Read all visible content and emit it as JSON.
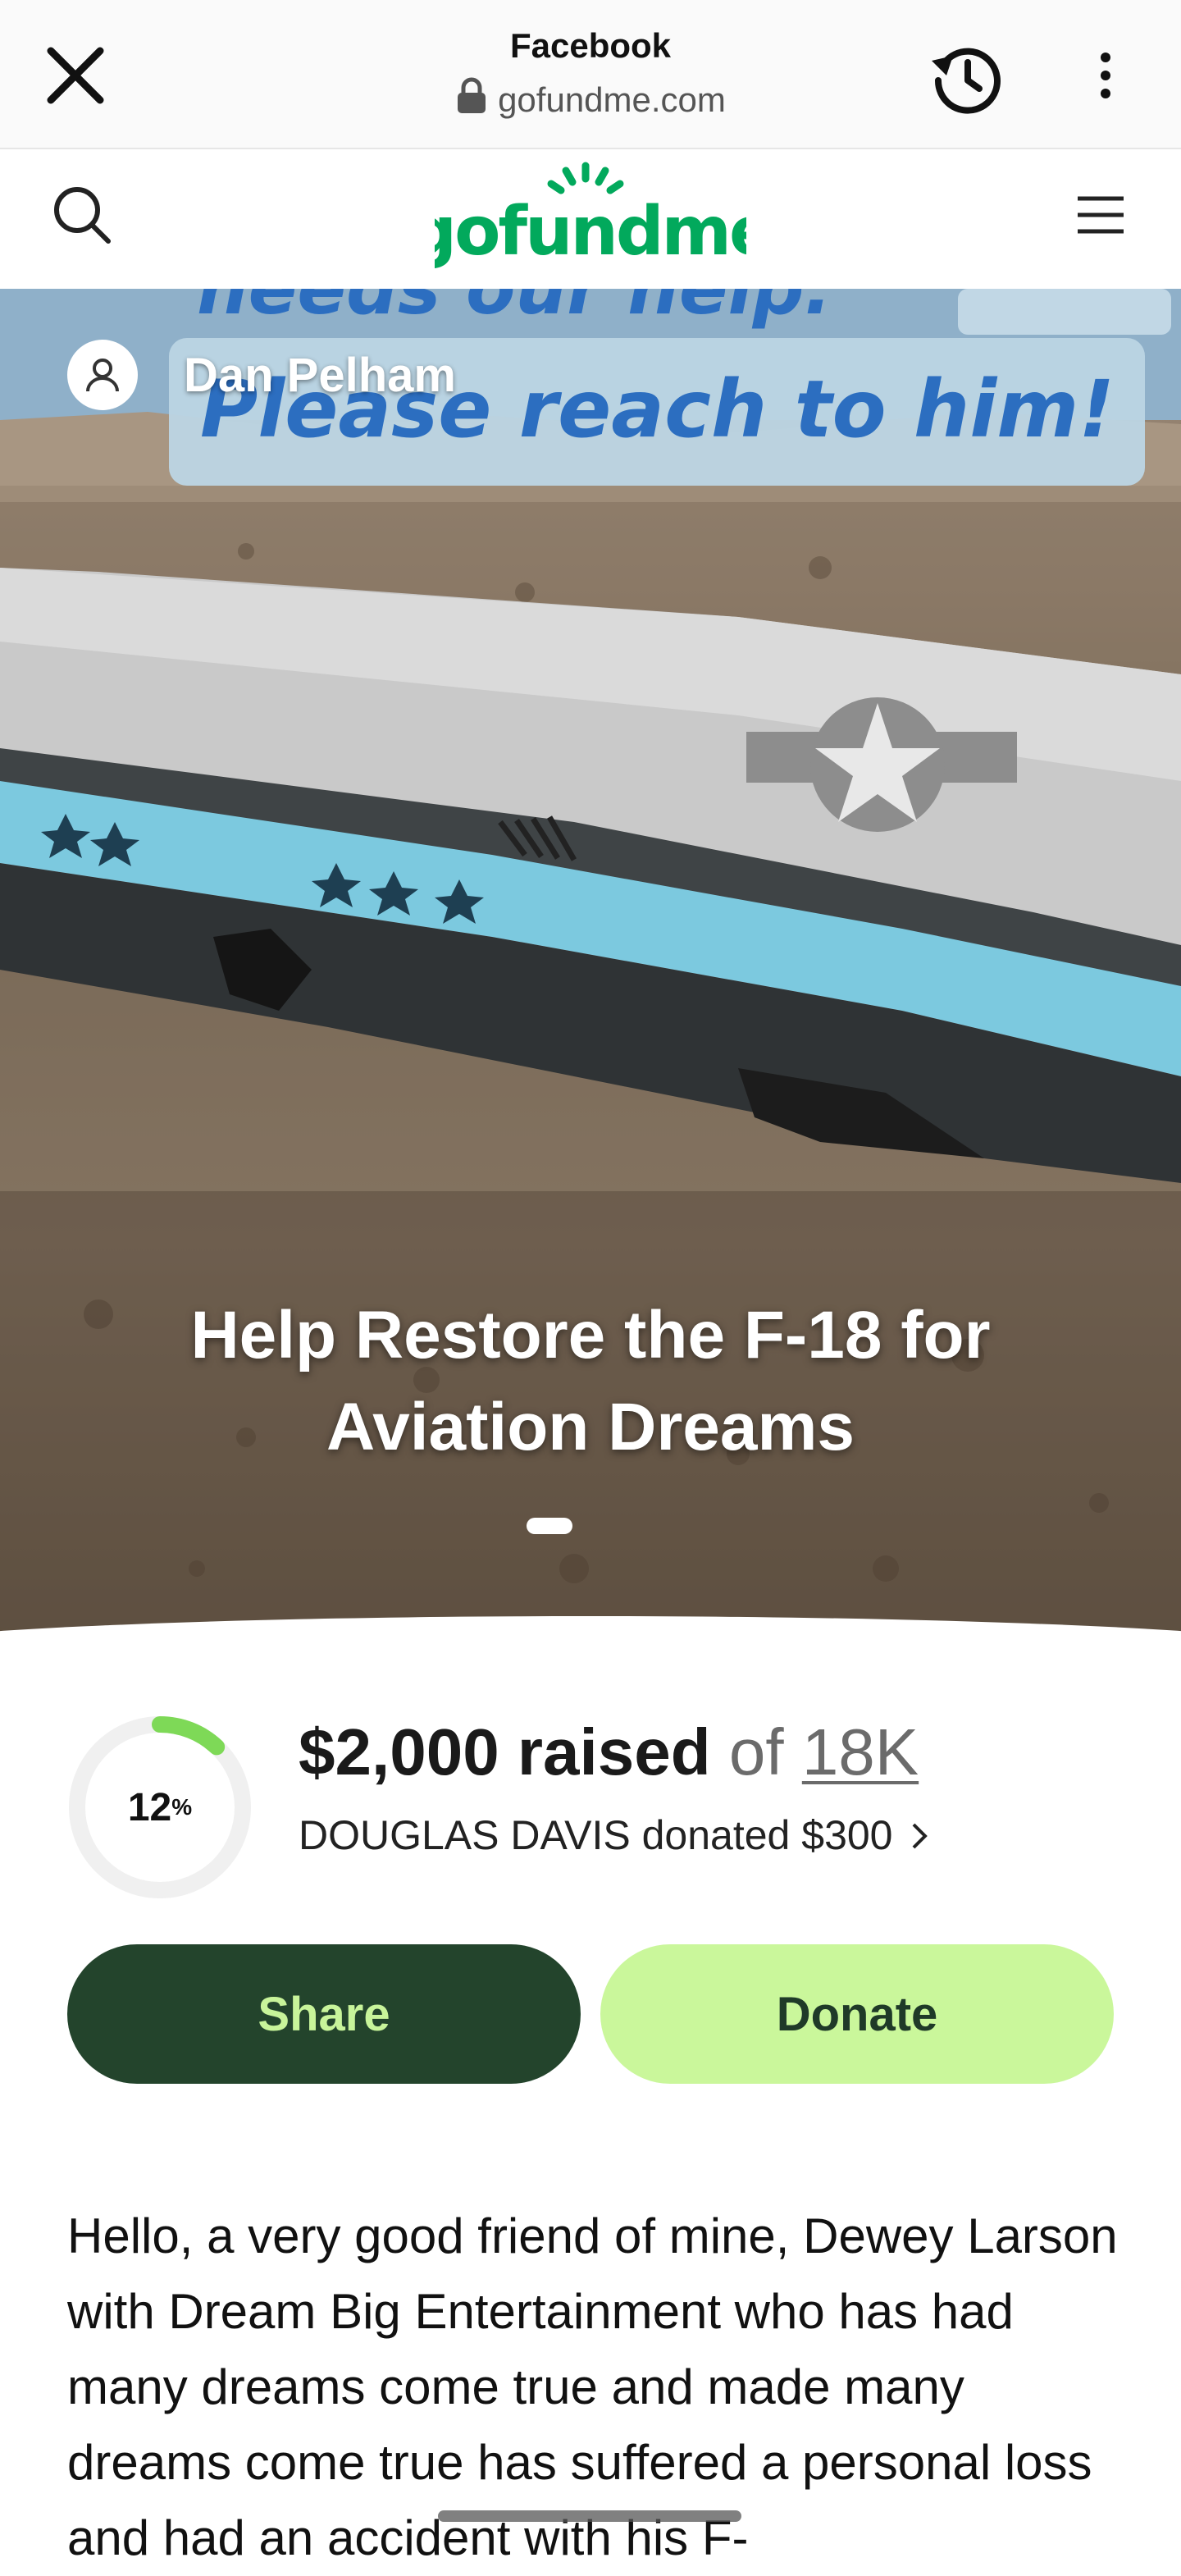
{
  "browser": {
    "close_icon": "close-icon",
    "page_title": "Facebook",
    "url": "gofundme.com",
    "lock_icon": "lock-icon",
    "history_icon": "history-icon",
    "more_icon": "more-vertical-icon"
  },
  "site_header": {
    "search_icon": "search-icon",
    "logo_text": "gofundme",
    "menu_icon": "hamburger-menu-icon"
  },
  "hero": {
    "banner_text_line1": "needs our help.",
    "banner_text_line2": "Please reach to him!",
    "organizer_name": "Dan Pelham",
    "avatar_icon": "user-avatar-icon",
    "campaign_title": "Help Restore the F-18 for Aviation Dreams"
  },
  "progress": {
    "percent_value": 0.12,
    "percent_label": "12",
    "percent_sign": "%",
    "raised_amount": "$2,000 raised",
    "of_text": "of",
    "goal": "18K",
    "recent_donation": "DOUGLAS DAVIS donated $300",
    "chevron_icon": "chevron-right-icon",
    "ring_color": "#7ed957",
    "track_color": "#f0f0f0"
  },
  "actions": {
    "share_label": "Share",
    "donate_label": "Donate"
  },
  "story": {
    "text": "Hello, a very good friend of mine, Dewey Larson with Dream Big Entertainment who has had many dreams come true and made many dreams come true has suffered a personal loss and had an accident with his F-"
  },
  "colors": {
    "brand_green": "#02a95c",
    "share_bg": "#23442c",
    "donate_bg": "#caf79b"
  }
}
